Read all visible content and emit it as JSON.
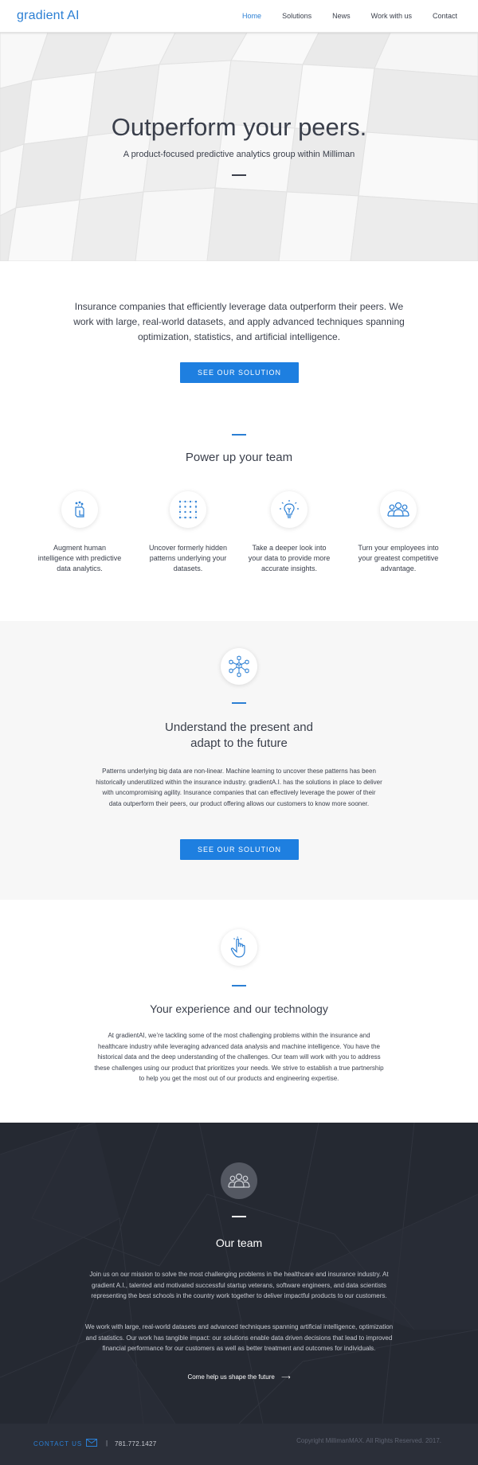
{
  "nav": {
    "logo": "gradient AI",
    "items": [
      {
        "label": "Home",
        "active": true
      },
      {
        "label": "Solutions"
      },
      {
        "label": "News"
      },
      {
        "label": "Work with us"
      },
      {
        "label": "Contact"
      }
    ]
  },
  "hero": {
    "title": "Outperform your peers.",
    "subtitle": "A product-focused predictive analytics group within Milliman"
  },
  "intro": {
    "text": "Insurance companies that efficiently leverage data outperform their peers. We work with large, real-world datasets, and apply advanced techniques spanning optimization, statistics, and artificial intelligence.",
    "button": "SEE OUR SOLUTION"
  },
  "power": {
    "title": "Power up your team",
    "features": [
      {
        "icon": "clipboard-sparkle-icon",
        "text": "Augment human intelligence with predictive data analytics."
      },
      {
        "icon": "dot-grid-icon",
        "text": "Uncover formerly hidden patterns underlying your datasets."
      },
      {
        "icon": "lightbulb-icon",
        "text": "Take a deeper look into your data to provide more accurate insights."
      },
      {
        "icon": "people-group-icon",
        "text": "Turn your employees into your greatest competitive advantage."
      }
    ]
  },
  "understand": {
    "icon": "network-cubes-icon",
    "title_line1": "Understand the present and",
    "title_line2": "adapt to the future",
    "body": "Patterns underlying big data are non-linear. Machine learning to uncover these patterns has been historically underutilized within the insurance industry. gradientA.I. has the solutions in place to deliver with uncompromising agility. Insurance companies that can effectively leverage the power of their data outperform their peers, our product offering allows our customers to know more sooner.",
    "button": "SEE OUR SOLUTION"
  },
  "experience": {
    "icon": "pointer-hand-icon",
    "title": "Your experience and our technology",
    "body": "At gradientAI, we’re tackling some of the most challenging problems within the insurance and healthcare industry while leveraging advanced data analysis and machine intelligence. You have the historical data and the deep understanding of the challenges. Our team will work with you to address these challenges using our product that prioritizes your needs. We strive to establish a true partnership to help you get the most out of our products and engineering expertise."
  },
  "team": {
    "icon": "people-group-icon",
    "title": "Our team",
    "body1": "Join us on our mission to solve the most challenging problems in the healthcare and insurance industry. At gradient A.I., talented and motivated successful startup veterans, software engineers, and data scientists representing the best schools in the country work together to deliver impactful products to our customers.",
    "body2": "We work with large, real-world datasets and advanced techniques spanning artificial intelligence, optimization and statistics. Our work has tangible impact: our solutions enable data driven decisions that lead to improved financial performance for our customers as well as better treatment and outcomes for individuals.",
    "cta": "Come help us shape the future"
  },
  "footer": {
    "contact": "CONTACT US",
    "separator": "|",
    "phone": "781.772.1427",
    "copyright": "Copyright MillimanMAX. All Rights Reserved. 2017."
  },
  "colors": {
    "accent": "#2b7fd4",
    "button": "#1e7fe0",
    "dark_bg": "#262a33",
    "footer_bg": "#2b2f39",
    "grey_bg": "#f7f7f7"
  }
}
